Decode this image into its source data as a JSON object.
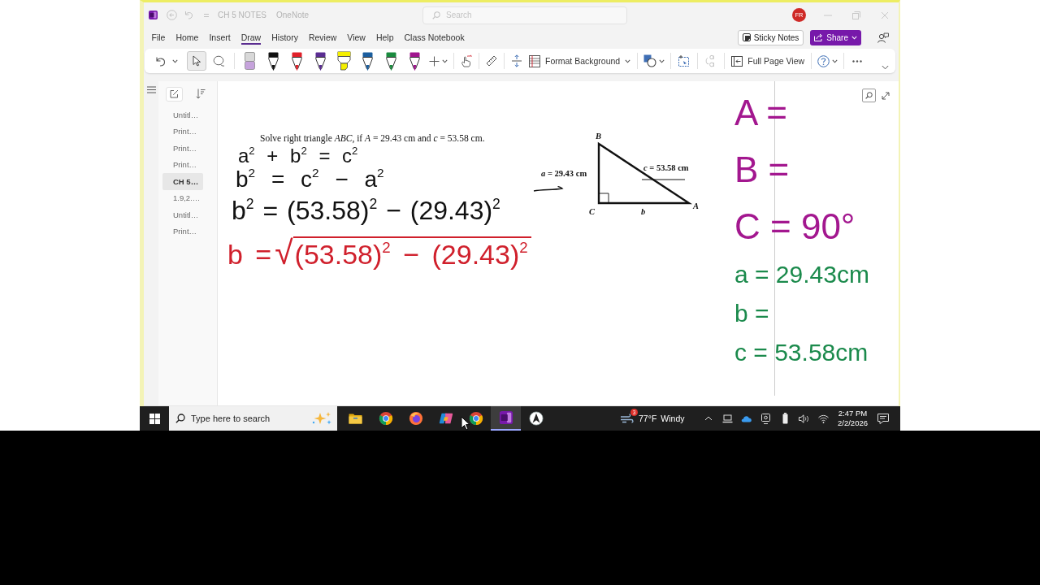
{
  "window": {
    "title": "CH 5 NOTES",
    "app_name": "OneNote",
    "search": {
      "placeholder": "Search"
    },
    "avatar": "FR"
  },
  "menu": {
    "tabs": [
      {
        "label": "File",
        "selected": false
      },
      {
        "label": "Home",
        "selected": false
      },
      {
        "label": "Insert",
        "selected": false
      },
      {
        "label": "Draw",
        "selected": true
      },
      {
        "label": "History",
        "selected": false
      },
      {
        "label": "Review",
        "selected": false
      },
      {
        "label": "View",
        "selected": false
      },
      {
        "label": "Help",
        "selected": false
      },
      {
        "label": "Class Notebook",
        "selected": false
      }
    ],
    "sticky_notes": "Sticky Notes",
    "share": "Share"
  },
  "ribbon": {
    "tools": [
      {
        "kind": "select",
        "selected": true
      },
      {
        "kind": "lasso",
        "selected": false
      }
    ],
    "pens": [
      {
        "kind": "eraser",
        "selected": false
      },
      {
        "kind": "pen",
        "color": "#111111",
        "selected": false
      },
      {
        "kind": "pen",
        "color": "#e0202a",
        "selected": false
      },
      {
        "kind": "pen",
        "color": "#5a2d91",
        "selected": false
      },
      {
        "kind": "highlighter",
        "color": "#f4ef00",
        "selected": false
      },
      {
        "kind": "pen",
        "color": "#1b5e9e",
        "selected": false
      },
      {
        "kind": "pen",
        "color": "#1a8a3e",
        "selected": false
      },
      {
        "kind": "pen",
        "color": "#a0168e",
        "selected": false
      }
    ],
    "format_background": "Format Background",
    "actions": [
      {
        "kind": "shapes",
        "disabled": false
      },
      {
        "kind": "ink-to-shape",
        "disabled": false
      },
      {
        "kind": "ink-to-text",
        "disabled": true
      }
    ],
    "full_page_view": "Full Page View"
  },
  "sidebar": {
    "pages": [
      {
        "label": "Untitl…",
        "selected": false
      },
      {
        "label": "Print…",
        "selected": false
      },
      {
        "label": "Print…",
        "selected": false
      },
      {
        "label": "Print…",
        "selected": false
      },
      {
        "label": "CH 5…",
        "selected": true
      },
      {
        "label": "1.9,2.…",
        "selected": false
      },
      {
        "label": "Untitl…",
        "selected": false
      },
      {
        "label": "Print…",
        "selected": false
      }
    ]
  },
  "page": {
    "problem": "Solve right triangle *ABC*, if *A* = 29.43 cm and *c* = 53.58 cm.",
    "ink_work": [
      {
        "kind": "line",
        "text": "a$^{2}$ + b$^{2}$ = c$^{2}$",
        "color": "#111111"
      },
      {
        "kind": "line",
        "text": "b$^{2}$ = c$^{2}$ − a$^{2}$",
        "color": "#111111"
      },
      {
        "kind": "line",
        "text": "b$^{2}$ = (53.58)$^{2}$ − (29.43)$^{2}$",
        "color": "#111111"
      },
      {
        "kind": "radical",
        "prefix": "b =",
        "sign": "√",
        "radicand": "(53.58)$^{2}$ − (29.43)$^{2}$",
        "color": "#d0202c"
      }
    ],
    "figure": {
      "top_vertex": "B",
      "right_angle_vertex": "C",
      "far_vertex": "A",
      "bottom_side": "b",
      "left_side": "*a* = 29.43 cm",
      "hypotenuse": "*c* = 53.58 cm"
    },
    "summary": [
      {
        "kind": "angle",
        "text": "A =",
        "color": "#a3178f"
      },
      {
        "kind": "angle",
        "text": "B =",
        "color": "#a3178f"
      },
      {
        "kind": "angle",
        "text": "C = 90°",
        "color": "#a3178f"
      },
      {
        "kind": "side",
        "text": "a = 29.43cm",
        "color": "#1b8a4c"
      },
      {
        "kind": "side",
        "text": "b =",
        "color": "#1b8a4c"
      },
      {
        "kind": "side",
        "text": "c = 53.58cm",
        "color": "#1b8a4c"
      }
    ]
  },
  "taskbar": {
    "search": {
      "placeholder": "Type here to search"
    },
    "apps": [
      {
        "kind": "folder",
        "selected": false
      },
      {
        "kind": "chrome",
        "selected": false
      },
      {
        "kind": "firefox",
        "selected": false
      },
      {
        "kind": "copilot",
        "selected": false
      },
      {
        "kind": "chrome",
        "selected": false
      },
      {
        "kind": "onenote",
        "selected": true
      },
      {
        "kind": "arrow",
        "selected": false
      }
    ],
    "weather": {
      "badge": "3",
      "temperature": "77°F",
      "condition": "Windy"
    },
    "time": "2:47 PM",
    "date": "2/2/2026"
  }
}
